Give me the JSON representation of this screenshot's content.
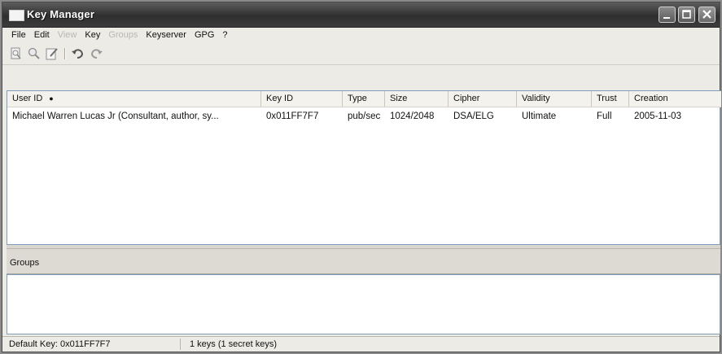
{
  "window": {
    "title": "Key Manager",
    "icon": "window-icon",
    "controls": [
      "minimize-icon",
      "maximize-icon",
      "close-icon"
    ]
  },
  "menu": {
    "items": [
      {
        "label": "File",
        "enabled": true
      },
      {
        "label": "Edit",
        "enabled": true
      },
      {
        "label": "View",
        "enabled": false
      },
      {
        "label": "Key",
        "enabled": true
      },
      {
        "label": "Groups",
        "enabled": false
      },
      {
        "label": "Keyserver",
        "enabled": true
      },
      {
        "label": "GPG",
        "enabled": true
      },
      {
        "label": "?",
        "enabled": true
      }
    ]
  },
  "toolbar": {
    "tools": [
      "key-properties-icon",
      "key-search-icon",
      "edit-key-icon",
      "undo-icon",
      "redo-icon"
    ]
  },
  "keys": {
    "columns": [
      "User ID",
      "Key ID",
      "Type",
      "Size",
      "Cipher",
      "Validity",
      "Trust",
      "Creation"
    ],
    "sort_indicator": "●",
    "rows": [
      {
        "user_id": "Michael Warren Lucas Jr (Consultant, author, sy...",
        "key_id": "0x011FF7F7",
        "type": "pub/sec",
        "size": "1024/2048",
        "cipher": "DSA/ELG",
        "validity": "Ultimate",
        "trust": "Full",
        "creation": "2005-11-03"
      }
    ]
  },
  "groups": {
    "label": "Groups"
  },
  "status": {
    "default_key": "Default Key: 0x011FF7F7",
    "key_count": "1 keys (1 secret keys)"
  },
  "colors": {
    "titlebar": "#3b3b3b",
    "window_bg": "#ecebe6",
    "list_border": "#7f9db9"
  }
}
